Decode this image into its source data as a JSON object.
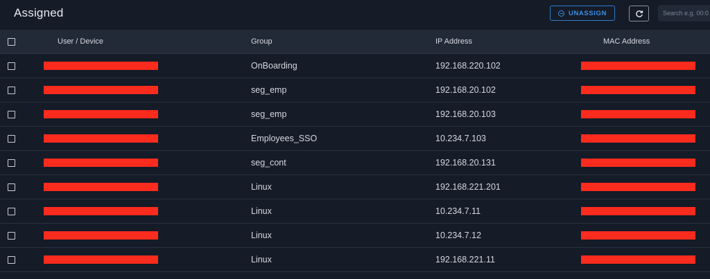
{
  "header": {
    "title": "Assigned",
    "unassign_label": "UNASSIGN",
    "search_placeholder": "Search e.g. 00:0"
  },
  "colors": {
    "background": "#151b27",
    "header_row": "#232a37",
    "accent_blue": "#2f7fd1",
    "redaction_red": "#fb2b1d"
  },
  "table": {
    "columns": {
      "user": "User / Device",
      "group": "Group",
      "ip": "IP Address",
      "mac": "MAC Address"
    },
    "rows": [
      {
        "group": "OnBoarding",
        "ip": "192.168.220.102"
      },
      {
        "group": "seg_emp",
        "ip": "192.168.20.102"
      },
      {
        "group": "seg_emp",
        "ip": "192.168.20.103"
      },
      {
        "group": "Employees_SSO",
        "ip": "10.234.7.103"
      },
      {
        "group": "seg_cont",
        "ip": "192.168.20.131"
      },
      {
        "group": "Linux",
        "ip": "192.168.221.201"
      },
      {
        "group": "Linux",
        "ip": "10.234.7.11"
      },
      {
        "group": "Linux",
        "ip": "10.234.7.12"
      },
      {
        "group": "Linux",
        "ip": "192.168.221.11"
      }
    ]
  }
}
